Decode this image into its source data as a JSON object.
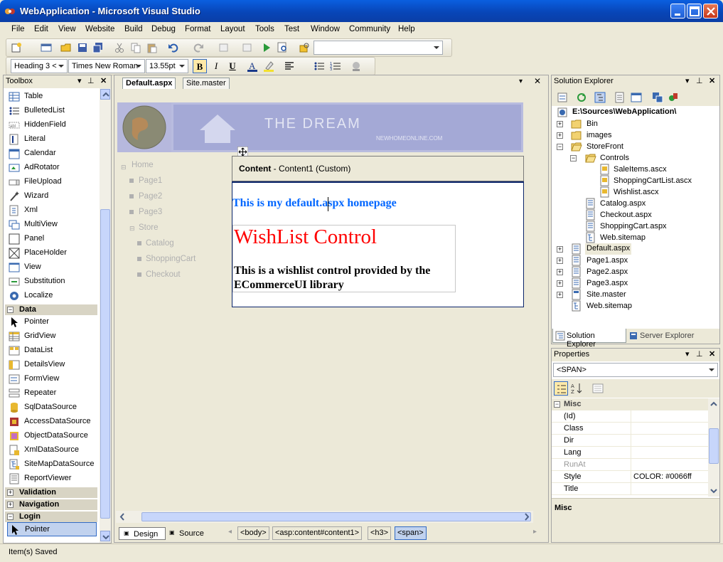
{
  "window": {
    "title": "WebApplication - Microsoft Visual Studio"
  },
  "menu": [
    "File",
    "Edit",
    "View",
    "Website",
    "Build",
    "Debug",
    "Format",
    "Layout",
    "Tools",
    "Test",
    "Window",
    "Community",
    "Help"
  ],
  "format_bar": {
    "block_format": "Heading 3 <",
    "font_name": "Times New Roman",
    "font_size": "13.55pt",
    "bold": "B",
    "italic": "I",
    "underline": "U"
  },
  "toolbox": {
    "title": "Toolbox",
    "standard_items": [
      "Table",
      "BulletedList",
      "HiddenField",
      "Literal",
      "Calendar",
      "AdRotator",
      "FileUpload",
      "Wizard",
      "Xml",
      "MultiView",
      "Panel",
      "PlaceHolder",
      "View",
      "Substitution",
      "Localize"
    ],
    "data_category": "Data",
    "data_items": [
      "Pointer",
      "GridView",
      "DataList",
      "DetailsView",
      "FormView",
      "Repeater",
      "SqlDataSource",
      "AccessDataSource",
      "ObjectDataSource",
      "XmlDataSource",
      "SiteMapDataSource",
      "ReportViewer"
    ],
    "collapsed_categories": [
      "Validation",
      "Navigation"
    ],
    "login_category": "Login",
    "login_items": [
      "Pointer"
    ]
  },
  "editor": {
    "tabs": [
      "Default.aspx",
      "Site.master"
    ],
    "banner_text": "THE DREAM",
    "banner_subtext": "NEWHOMEONLINE.COM",
    "nav": [
      "Home",
      "Page1",
      "Page2",
      "Page3",
      "Store",
      "Catalog",
      "ShoppingCart",
      "Checkout"
    ],
    "content_header_bold": "Content",
    "content_header_rest": " - Content1 (Custom)",
    "heading_text": "This is my default.aspx homepage",
    "wishlist_title": "WishList Control",
    "wishlist_body": "This is a wishlist control provided by the ECommerceUI library",
    "view_design": "Design",
    "view_source": "Source",
    "tag_path": [
      "<body>",
      "<asp:content#content1>",
      "<h3>",
      "<span>"
    ]
  },
  "solution_explorer": {
    "title": "Solution Explorer",
    "root": "E:\\Sources\\WebApplication\\",
    "items": [
      {
        "label": "Bin"
      },
      {
        "label": "images"
      },
      {
        "label": "StoreFront"
      },
      {
        "label": "Controls"
      },
      {
        "label": "SaleItems.ascx"
      },
      {
        "label": "ShoppingCartList.ascx"
      },
      {
        "label": "Wishlist.ascx"
      },
      {
        "label": "Catalog.aspx"
      },
      {
        "label": "Checkout.aspx"
      },
      {
        "label": "ShoppingCart.aspx"
      },
      {
        "label": "Web.sitemap"
      },
      {
        "label": "Default.aspx"
      },
      {
        "label": "Page1.aspx"
      },
      {
        "label": "Page2.aspx"
      },
      {
        "label": "Page3.aspx"
      },
      {
        "label": "Site.master"
      },
      {
        "label": "Web.sitemap"
      }
    ],
    "tabs": [
      "Solution Explorer",
      "Server Explorer"
    ]
  },
  "properties": {
    "title": "Properties",
    "object": "<SPAN>",
    "category": "Misc",
    "rows": [
      {
        "name": "(Id)",
        "value": ""
      },
      {
        "name": "Class",
        "value": ""
      },
      {
        "name": "Dir",
        "value": ""
      },
      {
        "name": "Lang",
        "value": ""
      },
      {
        "name": "RunAt",
        "value": ""
      },
      {
        "name": "Style",
        "value": "COLOR: #0066ff"
      },
      {
        "name": "Title",
        "value": ""
      }
    ],
    "description_title": "Misc"
  },
  "status_text": "Item(s) Saved",
  "colors": {
    "accent_blue": "#0066ff",
    "wishlist_red": "#ff0000",
    "selection": "#316ac5"
  }
}
